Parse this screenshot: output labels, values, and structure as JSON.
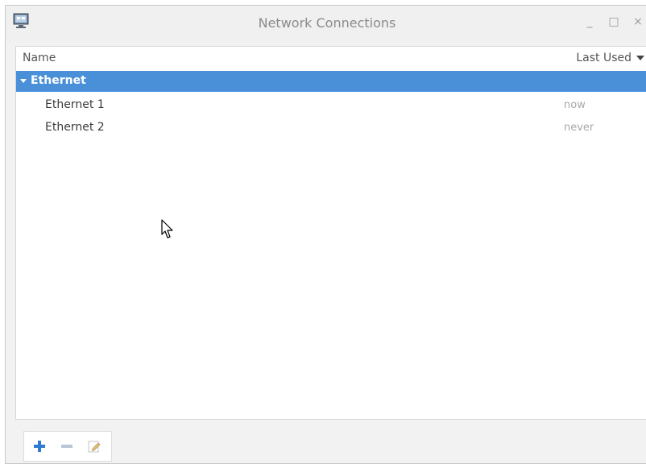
{
  "window": {
    "title": "Network Connections",
    "controls": {
      "minimize": "_",
      "maximize": "□",
      "close": "×"
    }
  },
  "list": {
    "columns": {
      "name": "Name",
      "last_used": "Last Used"
    },
    "group": {
      "label": "Ethernet"
    },
    "connections": [
      {
        "name": "Ethernet 1",
        "last_used": "now"
      },
      {
        "name": "Ethernet 2",
        "last_used": "never"
      }
    ]
  },
  "colors": {
    "selection": "#4a90d9",
    "add_icon": "#2f7bd2",
    "remove_icon": "#b8c6d6"
  },
  "icons": {
    "app": "network-connections-icon",
    "add": "plus-icon",
    "remove": "minus-icon",
    "edit": "edit-icon",
    "sort": "sort-desc-arrow-icon",
    "expander": "expander-down-icon",
    "cursor": "mouse-pointer-icon"
  }
}
